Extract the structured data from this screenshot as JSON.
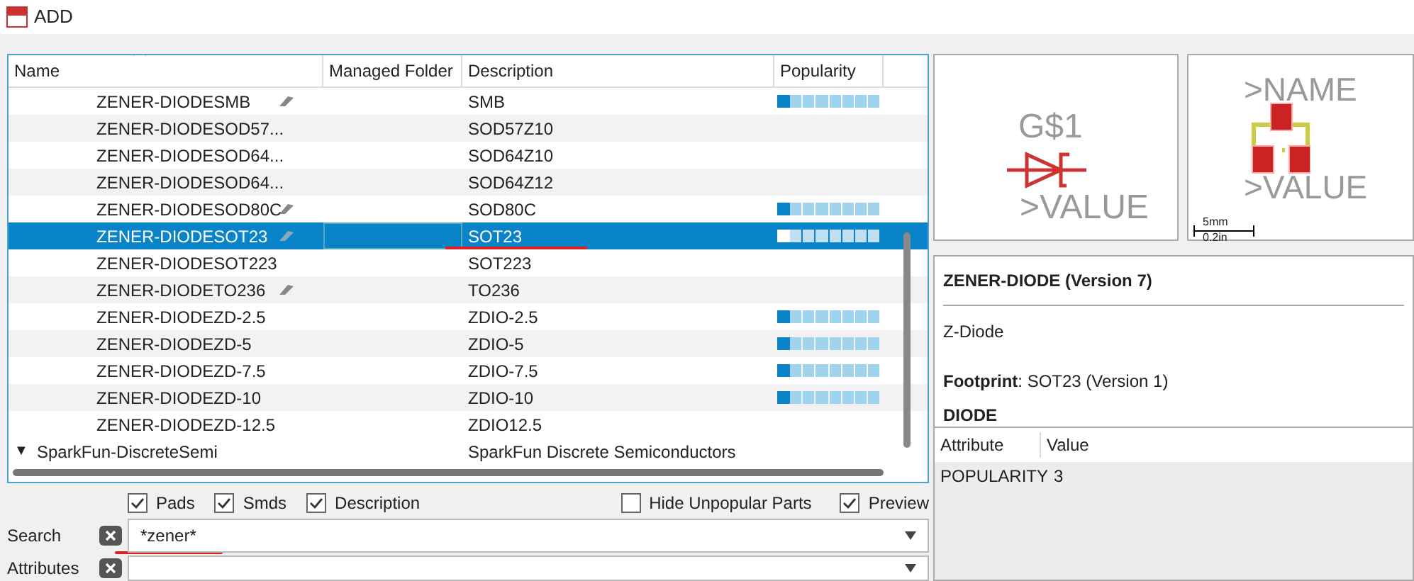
{
  "window": {
    "title": "ADD"
  },
  "table": {
    "columns": [
      "Name",
      "Managed Folder",
      "Description",
      "Popularity"
    ],
    "rows": [
      {
        "name": "ZENER-DIODESMB",
        "model_icon": true,
        "description": "SMB",
        "selected": false,
        "level": 0.125
      },
      {
        "name": "ZENER-DIODESOD57...",
        "model_icon": false,
        "description": "SOD57Z10",
        "selected": false
      },
      {
        "name": "ZENER-DIODESOD64...",
        "model_icon": false,
        "description": "SOD64Z10",
        "selected": false
      },
      {
        "name": "ZENER-DIODESOD64...",
        "model_icon": false,
        "description": "SOD64Z12",
        "selected": false
      },
      {
        "name": "ZENER-DIODESOD80C",
        "model_icon": true,
        "description": "SOD80C",
        "selected": false,
        "level": 0.125
      },
      {
        "name": "ZENER-DIODESOT23",
        "model_icon": true,
        "description": "SOT23",
        "selected": true,
        "level": 0.125
      },
      {
        "name": "ZENER-DIODESOT223",
        "model_icon": false,
        "description": "SOT223",
        "selected": false
      },
      {
        "name": "ZENER-DIODETO236",
        "model_icon": true,
        "description": "TO236",
        "selected": false
      },
      {
        "name": "ZENER-DIODEZD-2.5",
        "model_icon": false,
        "description": "ZDIO-2.5",
        "selected": false,
        "level": 0.125
      },
      {
        "name": "ZENER-DIODEZD-5",
        "model_icon": false,
        "description": "ZDIO-5",
        "selected": false,
        "level": 0.125
      },
      {
        "name": "ZENER-DIODEZD-7.5",
        "model_icon": false,
        "description": "ZDIO-7.5",
        "selected": false,
        "level": 0.125
      },
      {
        "name": "ZENER-DIODEZD-10",
        "model_icon": false,
        "description": "ZDIO-10",
        "selected": false,
        "level": 0.125
      },
      {
        "name": "ZENER-DIODEZD-12.5",
        "model_icon": false,
        "description": "ZDIO12.5",
        "selected": false
      }
    ],
    "group": {
      "toggle": "▼",
      "name": "SparkFun-DiscreteSemi",
      "description": "SparkFun Discrete Semiconductors",
      "expanded": true
    }
  },
  "options": [
    {
      "label": "Pads",
      "checked": true
    },
    {
      "label": "Smds",
      "checked": true
    },
    {
      "label": "Description",
      "checked": true
    },
    {
      "label": "Hide Unpopular Parts",
      "checked": false
    },
    {
      "label": "Preview",
      "checked": true
    }
  ],
  "search": {
    "label": "Search",
    "value": "*zener*"
  },
  "attributes_field": {
    "label": "Attributes"
  },
  "symbol_preview": {
    "name": "G$1",
    "value": ">VALUE"
  },
  "package_preview": {
    "name": ">NAME",
    "value": ">VALUE",
    "scale_top": "5mm",
    "scale_bottom": "0.2in"
  },
  "info": {
    "title": "ZENER-DIODE (Version 7)",
    "description": "Z-Diode",
    "footprint": "**Footprint**: SOT23 (Version 1)",
    "next_heading": "DIODE"
  },
  "attribute_table": {
    "columns": [
      "Attribute",
      "Value"
    ],
    "rows": [
      [
        "POPULARITY",
        "3"
      ]
    ]
  }
}
